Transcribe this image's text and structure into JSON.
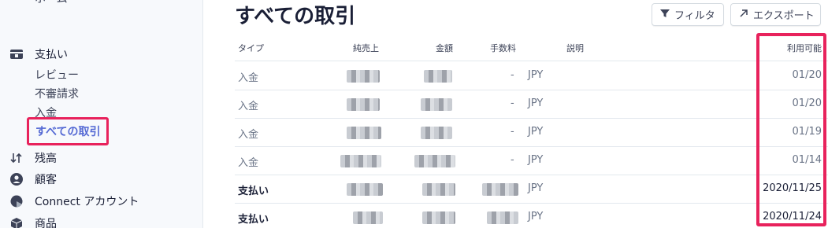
{
  "sidebar": {
    "top_label": "ホーム",
    "payments": {
      "label": "支払い",
      "icon": "payments-icon"
    },
    "sub_items": [
      {
        "label": "レビュー"
      },
      {
        "label": "不審請求"
      },
      {
        "label": "入金"
      }
    ],
    "active_item": {
      "label": "すべての取引"
    },
    "items": [
      {
        "label": "残高",
        "icon": "balance-arrows-icon"
      },
      {
        "label": "顧客",
        "icon": "customer-icon"
      },
      {
        "label": "Connect アカウント",
        "icon": "connect-icon"
      },
      {
        "label": "商品",
        "icon": "product-icon"
      }
    ],
    "accent": "#e8225c",
    "active_color": "#5469d4"
  },
  "main": {
    "title": "すべての取引",
    "filter_label": "フィルタ",
    "export_label": "エクスポート",
    "columns": [
      "タイプ",
      "純売上",
      "金額",
      "手数料",
      "説明",
      "利用可能"
    ],
    "rows": [
      {
        "type": "入金",
        "fee": "-",
        "currency": "JPY",
        "available": "01/20",
        "bold": false
      },
      {
        "type": "入金",
        "fee": "-",
        "currency": "JPY",
        "available": "01/20",
        "bold": false
      },
      {
        "type": "入金",
        "fee": "-",
        "currency": "JPY",
        "available": "01/19",
        "bold": false
      },
      {
        "type": "入金",
        "fee": "-",
        "currency": "JPY",
        "available": "01/14",
        "bold": false
      },
      {
        "type": "支払い",
        "fee": "",
        "currency": "JPY",
        "available": "2020/11/25",
        "bold": true
      },
      {
        "type": "支払い",
        "fee": "",
        "currency": "JPY",
        "available": "2020/11/24",
        "bold": true
      }
    ]
  }
}
